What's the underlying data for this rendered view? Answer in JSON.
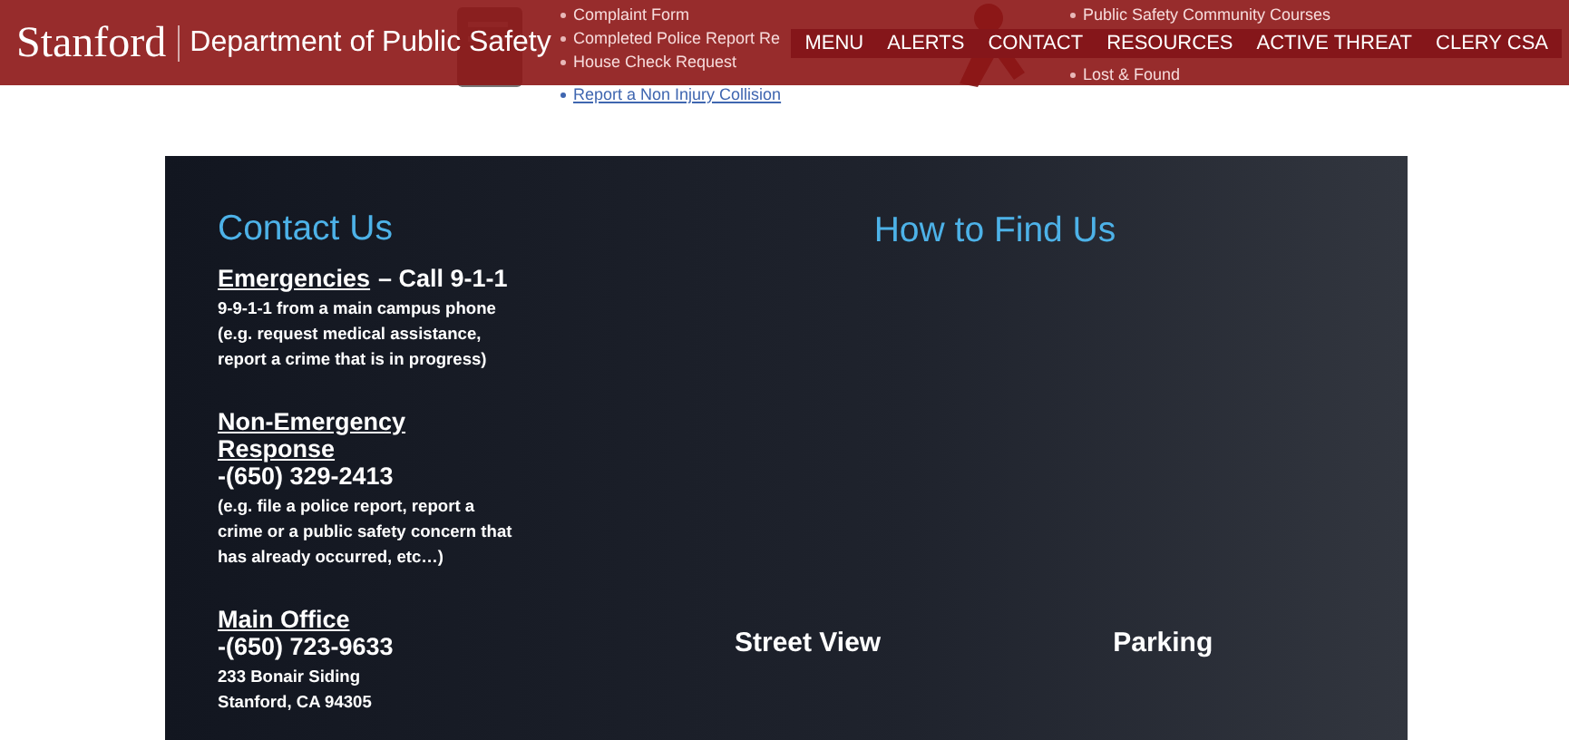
{
  "header": {
    "logo": "Stanford",
    "site_title": "Department of Public Safety",
    "nav": [
      {
        "label": "MENU"
      },
      {
        "label": "ALERTS"
      },
      {
        "label": "CONTACT"
      },
      {
        "label": "RESOURCES"
      },
      {
        "label": "ACTIVE THREAT"
      },
      {
        "label": "CLERY CSA"
      }
    ]
  },
  "background_links": {
    "left": [
      "Complaint Form",
      "Completed Police Report Re",
      "House Check Request",
      "Report a Non Injury Collision"
    ],
    "right": [
      "Public Safety Community Courses",
      "Lost & Found"
    ]
  },
  "contact": {
    "title": "Contact Us",
    "sections": [
      {
        "heading": "Emergencies",
        "suffix": "– Call 9-1-1",
        "details": [
          "9-9-1-1 from a main campus phone (e.g. request medical assistance, report a crime that is in progress)"
        ]
      },
      {
        "heading": "Non-Emergency Response",
        "phone": "-(650) 329-2413",
        "details": [
          "(e.g. file a police report, report a crime or a public safety concern that has already occurred, etc…)"
        ]
      },
      {
        "heading": "Main Office",
        "phone": "-(650) 723-9633",
        "details": [
          "233 Bonair Siding",
          "Stanford, CA 94305"
        ]
      }
    ]
  },
  "find_us": {
    "title": "How to Find Us",
    "links": [
      "Street View",
      "Parking"
    ]
  }
}
